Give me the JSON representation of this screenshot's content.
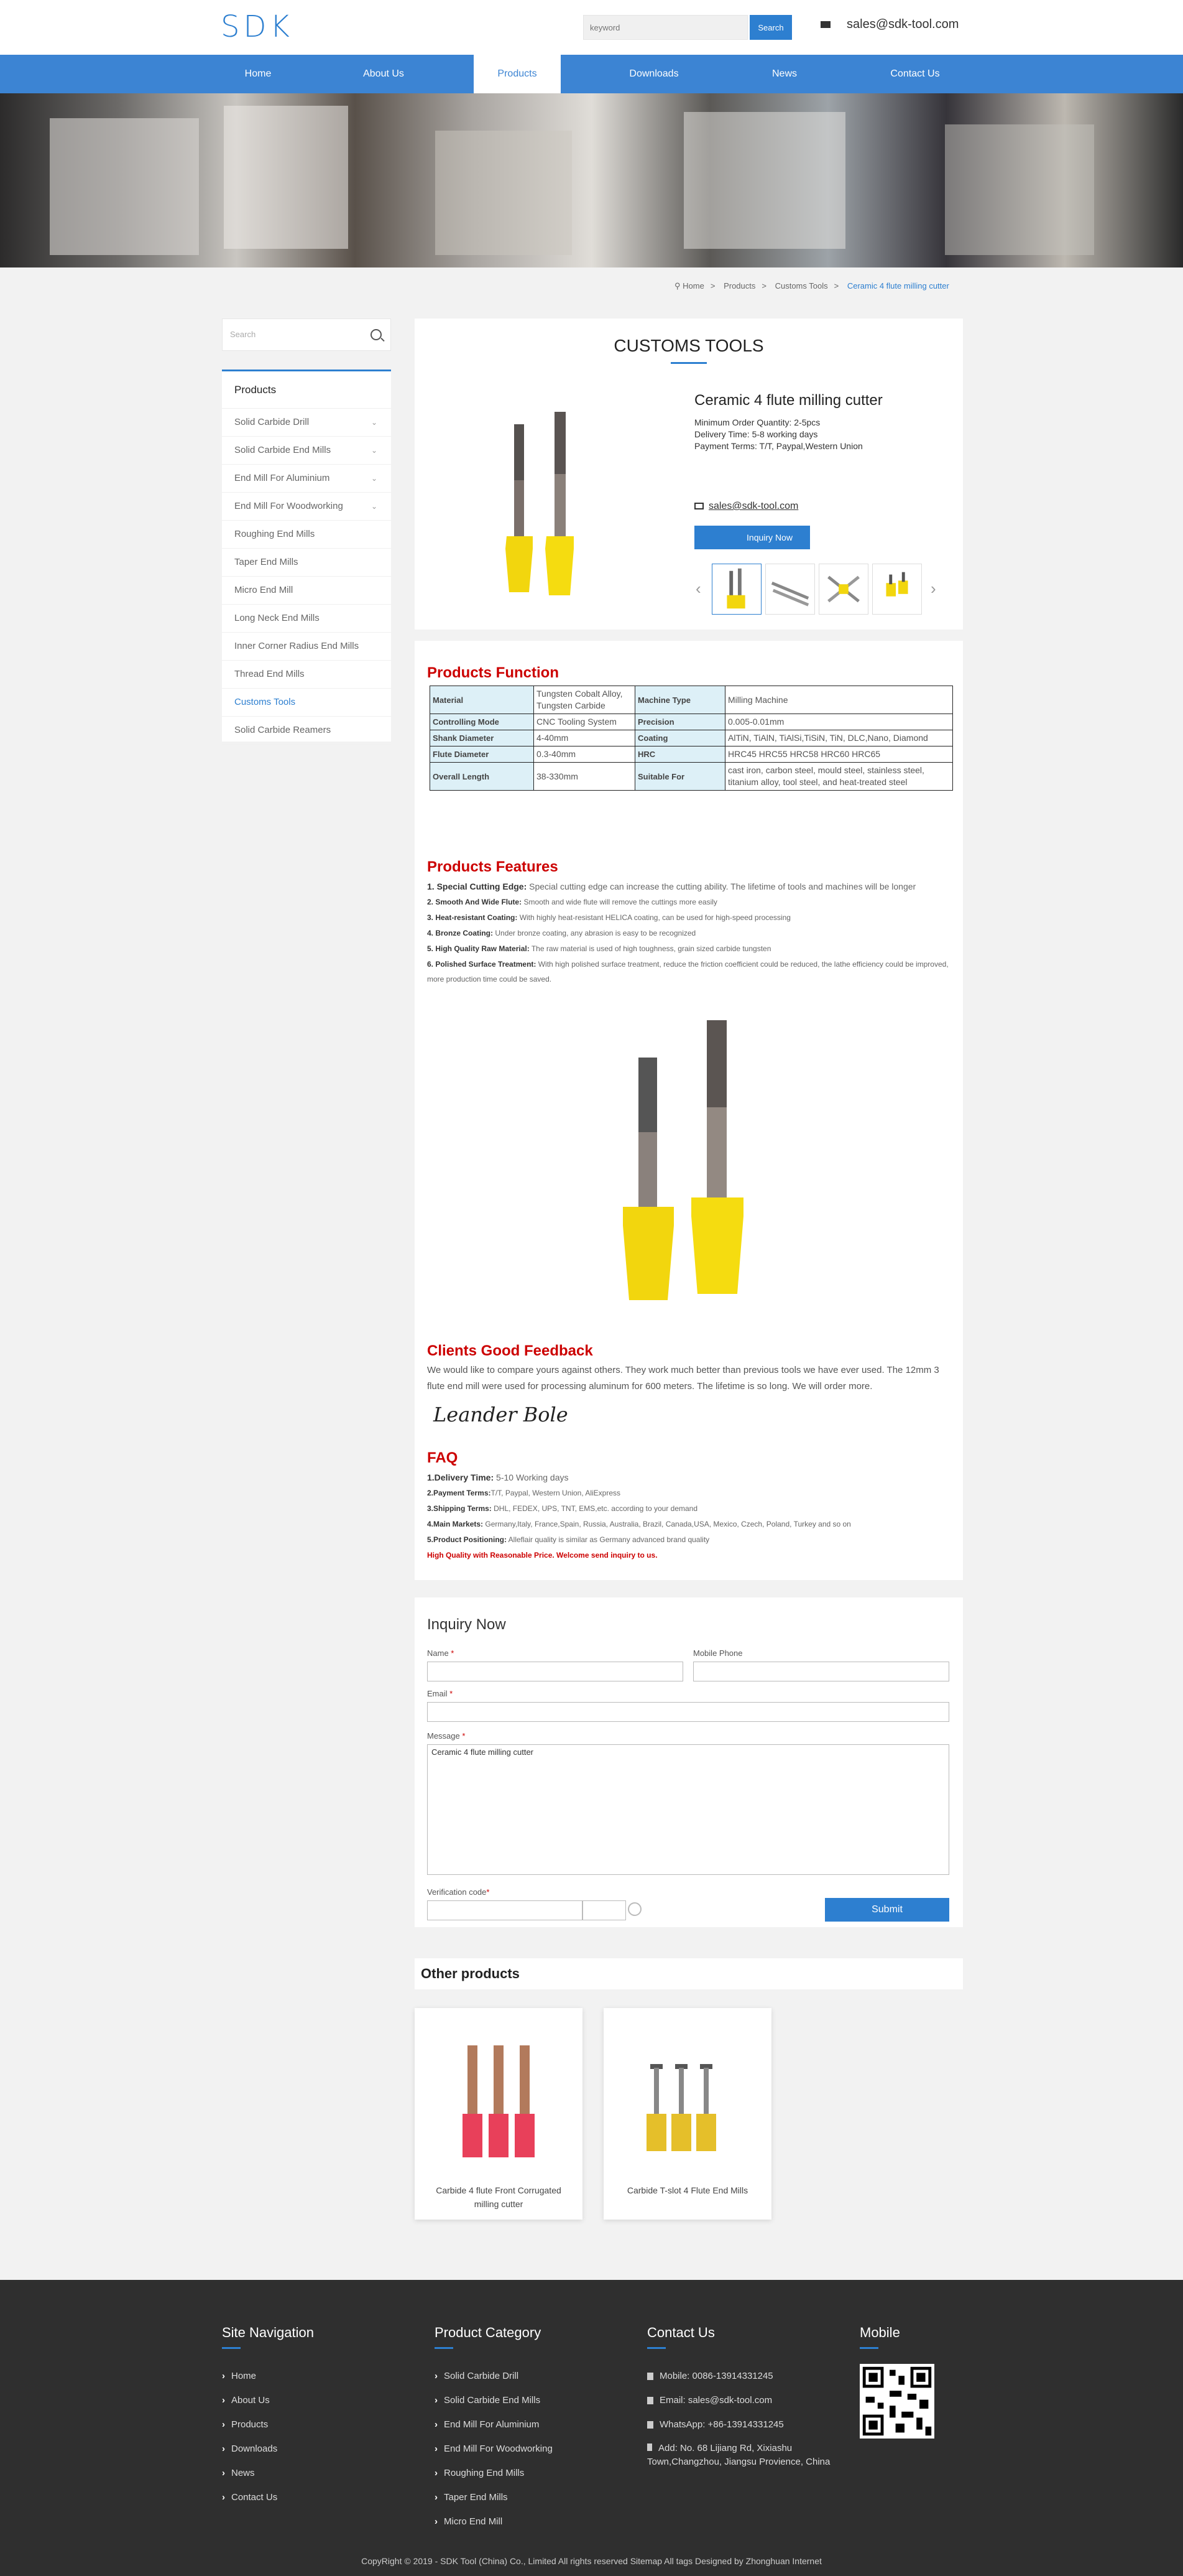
{
  "header": {
    "logo": "SDK",
    "search_placeholder": "keyword",
    "search_button": "Search",
    "email": "sales@sdk-tool.com"
  },
  "nav": {
    "items": [
      "Home",
      "About Us",
      "Products",
      "Downloads",
      "News",
      "Contact Us"
    ],
    "active": "Products"
  },
  "breadcrumb": [
    "Home",
    "Products",
    "Customs Tools",
    "Ceramic 4 flute milling cutter"
  ],
  "sidebar": {
    "search_placeholder": "Search",
    "title": "Products",
    "items": [
      {
        "label": "Solid Carbide Drill",
        "expand": true
      },
      {
        "label": "Solid Carbide End Mills",
        "expand": true
      },
      {
        "label": "End Mill For Aluminium",
        "expand": true
      },
      {
        "label": "End Mill For Woodworking",
        "expand": true
      },
      {
        "label": "Roughing End Mills",
        "expand": false
      },
      {
        "label": "Taper End Mills",
        "expand": false
      },
      {
        "label": "Micro End Mill",
        "expand": false
      },
      {
        "label": "Long Neck End Mills",
        "expand": false
      },
      {
        "label": "Inner Corner Radius End Mills",
        "expand": false
      },
      {
        "label": "Thread End Mills",
        "expand": false
      },
      {
        "label": "Customs Tools",
        "expand": false,
        "active": true
      },
      {
        "label": "Solid Carbide Reamers",
        "expand": false
      }
    ]
  },
  "product": {
    "category_title": "CUSTOMS TOOLS",
    "name": "Ceramic 4 flute milling cutter",
    "info": [
      "Minimum Order Quantity: 2-5pcs",
      "Delivery Time: 5-8 working days",
      "Payment Terms: T/T, Paypal,Western Union"
    ],
    "email": "sales@sdk-tool.com",
    "inquiry_button": "Inquiry Now"
  },
  "function": {
    "title": "Products Function",
    "rows": [
      [
        "Material",
        "Tungsten Cobalt Alloy, Tungsten Carbide",
        "Machine Type",
        "Milling Machine"
      ],
      [
        "Controlling Mode",
        "CNC Tooling System",
        "Precision",
        "0.005-0.01mm"
      ],
      [
        "Shank Diameter",
        "4-40mm",
        "Coating",
        "AlTiN, TiAlN, TiAlSi,TiSiN, TiN, DLC,Nano, Diamond"
      ],
      [
        "Flute Diameter",
        "0.3-40mm",
        "HRC",
        "HRC45 HRC55 HRC58 HRC60 HRC65"
      ],
      [
        "Overall Length",
        "38-330mm",
        "Suitable For",
        "cast iron, carbon steel, mould steel, stainless steel, titanium alloy, tool steel, and heat-treated steel"
      ]
    ]
  },
  "features": {
    "title": "Products Features",
    "items": [
      {
        "k": "1. Special Cutting Edge:",
        "v": " Special cutting edge can increase the cutting ability. The lifetime of tools and machines will be longer"
      },
      {
        "k": "2. Smooth And Wide Flute:",
        "v": " Smooth and wide flute will remove the cuttings more easily"
      },
      {
        "k": "3. Heat-resistant Coating:",
        "v": " With highly heat-resistant HELICA coating, can be used for high-speed processing"
      },
      {
        "k": "4. Bronze Coating:",
        "v": " Under bronze coating, any abrasion is easy to be recognized"
      },
      {
        "k": "5. High Quality Raw Material:",
        "v": " The raw material is used of high toughness, grain sized carbide tungsten"
      },
      {
        "k": "6. Polished Surface Treatment:",
        "v": " With high polished surface treatment, reduce the friction coefficient could be reduced, the lathe efficiency could be improved, more production time could be saved."
      }
    ]
  },
  "feedback": {
    "title": "Clients Good Feedback",
    "text": "We would like to compare yours against others. They work much better than previous tools we have ever used. The 12mm 3 flute end mill were used for processing aluminum for 600 meters. The lifetime is so long. We will order more.",
    "signature": "Leander Bole"
  },
  "faq": {
    "title": "FAQ",
    "items": [
      {
        "k": "1.Delivery Time:",
        "v": " 5-10 Working days"
      },
      {
        "k": "2.Payment Terms:",
        "v": "T/T, Paypal, Western Union, AliExpress"
      },
      {
        "k": "3.Shipping Terms:",
        "v": " DHL, FEDEX, UPS, TNT, EMS,etc. according to your demand"
      },
      {
        "k": "4.Main Markets:",
        "v": " Germany,Italy, France,Spain, Russia, Australia, Brazil, Canada,USA, Mexico, Czech, Poland, Turkey and so on"
      },
      {
        "k": "5.Product Positioning:",
        "v": " Alleflair quality is similar as Germany advanced brand quality"
      }
    ],
    "closing": "High Quality with Reasonable Price. Welcome send inquiry to us."
  },
  "inquiry": {
    "title": "Inquiry Now",
    "name_label": "Name ",
    "mobile_label": "Mobile Phone",
    "email_label": "Email ",
    "message_label": "Message ",
    "message_value": "Ceramic 4 flute milling cutter",
    "verify_label": "Verification code",
    "submit": "Submit",
    "required": "*"
  },
  "other": {
    "title": "Other products",
    "items": [
      "Carbide 4 flute Front Corrugated milling cutter",
      "Carbide T-slot 4 Flute End Mills"
    ]
  },
  "footer": {
    "nav_title": "Site Navigation",
    "nav_items": [
      "Home",
      "About Us",
      "Products",
      "Downloads",
      "News",
      "Contact Us"
    ],
    "cat_title": "Product Category",
    "cat_items": [
      "Solid Carbide Drill",
      "Solid Carbide End Mills",
      "End Mill For Aluminium",
      "End Mill For Woodworking",
      "Roughing End Mills",
      "Taper End Mills",
      "Micro End Mill"
    ],
    "contact_title": "Contact Us",
    "mobile": "Mobile: 0086-13914331245",
    "email": "Email: sales@sdk-tool.com",
    "whatsapp": "WhatsApp: +86-13914331245",
    "address": "Add: No. 68 Lijiang Rd, Xixiashu Town,Changzhou, Jiangsu  Provience, China",
    "mobile_title": "Mobile",
    "copyright": "CopyRight © 2019 -   SDK Tool (China) Co., Limited  All rights reserved Sitemap  All tags   Designed by Zhonghuan Internet"
  },
  "colors": {
    "brand": "#2d7fd0",
    "nav": "#3c84d3",
    "accent_red": "#cc0000",
    "footer": "#2f2f2f"
  }
}
